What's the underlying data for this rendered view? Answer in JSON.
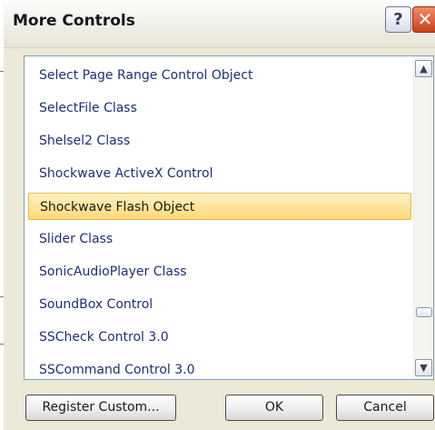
{
  "window": {
    "title": "More Controls",
    "help_glyph": "?",
    "close_glyph": "✕"
  },
  "list": {
    "items": [
      {
        "label": "Select Page Range Control Object",
        "selected": false
      },
      {
        "label": "SelectFile Class",
        "selected": false
      },
      {
        "label": "Shelsel2 Class",
        "selected": false
      },
      {
        "label": "Shockwave ActiveX Control",
        "selected": false
      },
      {
        "label": "Shockwave Flash Object",
        "selected": true
      },
      {
        "label": "Slider Class",
        "selected": false
      },
      {
        "label": "SonicAudioPlayer Class",
        "selected": false
      },
      {
        "label": "SoundBox Control",
        "selected": false
      },
      {
        "label": "SSCheck Control 3.0",
        "selected": false
      },
      {
        "label": "SSCommand Control 3.0",
        "selected": false
      }
    ],
    "scrollbar": {
      "up_glyph": "▲",
      "down_glyph": "▼"
    }
  },
  "buttons": {
    "register": "Register Custom...",
    "ok": "OK",
    "cancel": "Cancel"
  },
  "colors": {
    "selection": "#ffd878",
    "item_text": "#1f2f7a",
    "dialog_bg": "#ece9d8"
  }
}
